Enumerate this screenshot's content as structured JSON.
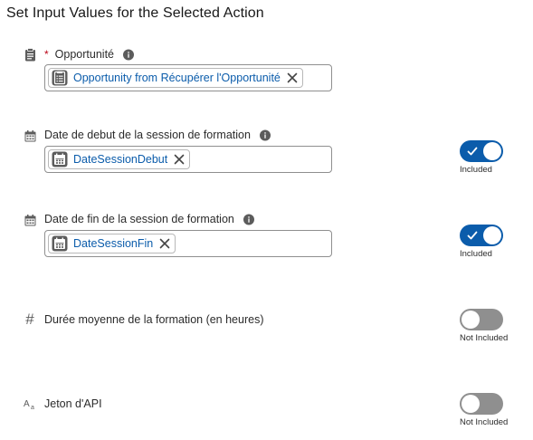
{
  "section": {
    "title": "Set Input Values for the Selected Action"
  },
  "fields": [
    {
      "label": "Opportunité",
      "required_mark": "*",
      "type_icon": "clipboard-icon",
      "value_pill": "Opportunity from Récupérer l'Opportunité",
      "pill_icon": "record-icon"
    },
    {
      "label": "Date de debut de la session de formation",
      "type_icon": "calendar-icon",
      "value_pill": "DateSessionDebut",
      "pill_icon": "calendar-icon",
      "toggle_state": "on",
      "toggle_text": "Included"
    },
    {
      "label": "Date de fin de la session de formation",
      "type_icon": "calendar-icon",
      "value_pill": "DateSessionFin",
      "pill_icon": "calendar-icon",
      "toggle_state": "on",
      "toggle_text": "Included"
    },
    {
      "label": "Durée moyenne de la formation (en heures)",
      "type_icon": "number-icon",
      "type_icon_glyph": "#",
      "toggle_state": "off",
      "toggle_text": "Not Included"
    },
    {
      "label": "Jeton d'API",
      "type_icon": "text-icon",
      "toggle_state": "off",
      "toggle_text": "Not Included"
    }
  ],
  "colors": {
    "accent": "#0b5cab",
    "required": "#ba0517",
    "toggle_off": "#8f8f8f",
    "icon_gray": "#5c5c5c"
  }
}
